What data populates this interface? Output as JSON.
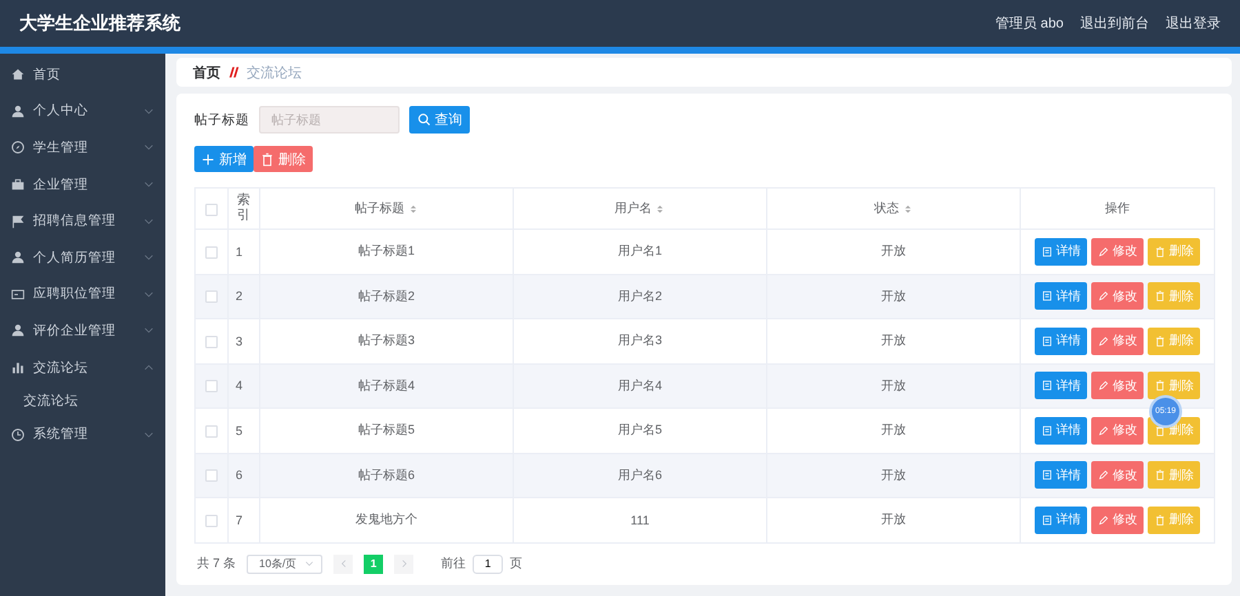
{
  "header": {
    "title": "大学生企业推荐系统",
    "user": "管理员 abo",
    "links": [
      "退出到前台",
      "退出登录"
    ]
  },
  "sidebar": {
    "items": [
      {
        "label": "首页",
        "kind": "link"
      },
      {
        "label": "个人中心",
        "kind": "menu",
        "expanded": false
      },
      {
        "label": "学生管理",
        "kind": "menu",
        "expanded": false
      },
      {
        "label": "企业管理",
        "kind": "menu",
        "expanded": false
      },
      {
        "label": "招聘信息管理",
        "kind": "menu",
        "expanded": false
      },
      {
        "label": "个人简历管理",
        "kind": "menu",
        "expanded": false
      },
      {
        "label": "应聘职位管理",
        "kind": "menu",
        "expanded": false
      },
      {
        "label": "评价企业管理",
        "kind": "menu",
        "expanded": false
      },
      {
        "label": "交流论坛",
        "kind": "menu",
        "expanded": true,
        "children": [
          {
            "label": "交流论坛"
          }
        ]
      },
      {
        "label": "系统管理",
        "kind": "menu",
        "expanded": false
      }
    ]
  },
  "breadcrumb": [
    "首页",
    "交流论坛"
  ],
  "search": {
    "label": "帖子标题",
    "placeholder": "帖子标题",
    "button": "查询"
  },
  "toolbar": [
    {
      "label": "新增",
      "kind": "add"
    },
    {
      "label": "删除",
      "kind": "delete"
    }
  ],
  "table": {
    "columns": [
      {
        "kind": "check",
        "checked": false
      },
      {
        "label": "索引",
        "sortable": false
      },
      {
        "label": "帖子标题",
        "sortable": true
      },
      {
        "label": "用户名",
        "sortable": true
      },
      {
        "label": "状态",
        "sortable": true
      },
      {
        "label": "操作",
        "sortable": false
      }
    ],
    "rows": [
      {
        "checked": false,
        "index": "1",
        "title": "帖子标题1",
        "user": "用户名1",
        "status": "开放",
        "actions": [
          "详情",
          "修改",
          "删除"
        ]
      },
      {
        "checked": false,
        "index": "2",
        "title": "帖子标题2",
        "user": "用户名2",
        "status": "开放",
        "actions": [
          "详情",
          "修改",
          "删除"
        ]
      },
      {
        "checked": false,
        "index": "3",
        "title": "帖子标题3",
        "user": "用户名3",
        "status": "开放",
        "actions": [
          "详情",
          "修改",
          "删除"
        ]
      },
      {
        "checked": false,
        "index": "4",
        "title": "帖子标题4",
        "user": "用户名4",
        "status": "开放",
        "actions": [
          "详情",
          "修改",
          "删除"
        ]
      },
      {
        "checked": false,
        "index": "5",
        "title": "帖子标题5",
        "user": "用户名5",
        "status": "开放",
        "actions": [
          "详情",
          "修改",
          "删除"
        ]
      },
      {
        "checked": false,
        "index": "6",
        "title": "帖子标题6",
        "user": "用户名6",
        "status": "开放",
        "actions": [
          "详情",
          "修改",
          "删除"
        ]
      },
      {
        "checked": false,
        "index": "7",
        "title": "发鬼地方个",
        "user": "111",
        "status": "开放",
        "actions": [
          "详情",
          "修改",
          "删除"
        ]
      }
    ]
  },
  "pagination": {
    "total": "共 7 条",
    "page_size": "10条/页",
    "pages": [
      {
        "label": "1",
        "selected": true
      }
    ],
    "goto_label": "前往",
    "goto_value": "1",
    "page_suffix": "页"
  },
  "timer": {
    "text": "05:19"
  }
}
